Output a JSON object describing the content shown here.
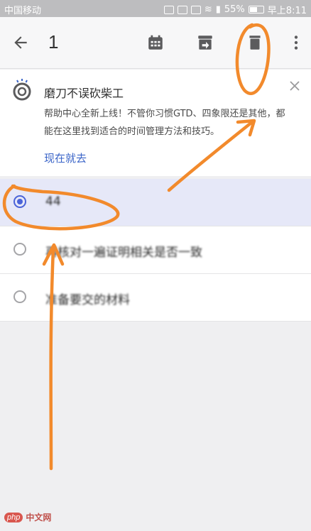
{
  "status_bar": {
    "carrier": "中国移动",
    "battery": "55%",
    "time": "早上8:11"
  },
  "app_bar": {
    "title": "1",
    "icons": [
      "back-arrow-icon",
      "calendar-icon",
      "move-to-icon",
      "delete-icon",
      "more-vert-icon"
    ]
  },
  "promo": {
    "title": "磨刀不误砍柴工",
    "body": "帮助中心全新上线！不管你习惯GTD、四象限还是其他，都能在这里找到适合的时间管理方法和技巧。",
    "link": "现在就去"
  },
  "tasks": [
    {
      "text": "44",
      "selected": true
    },
    {
      "text": "再核对一遍证明相关是否一致",
      "selected": false
    },
    {
      "text": "准备要交的材料",
      "selected": false
    }
  ],
  "watermark": {
    "logo": "php",
    "site": "中文网"
  },
  "colors": {
    "accent": "#4a63d8",
    "link": "#3a64c8",
    "annotation": "#f28a2c"
  }
}
